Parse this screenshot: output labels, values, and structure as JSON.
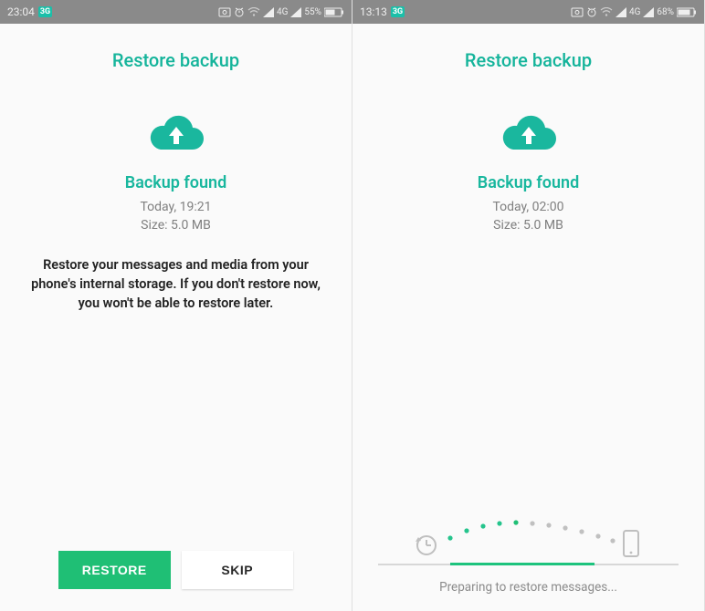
{
  "colors": {
    "teal": "#19b79e",
    "green": "#1dc37d",
    "grey": "#8a8a8a"
  },
  "left": {
    "status": {
      "time": "23:04",
      "signal_badge": "3G",
      "net": "4G",
      "battery": "55%"
    },
    "title": "Restore backup",
    "subheading": "Backup found",
    "meta_line1": "Today, 19:21",
    "meta_line2": "Size: 5.0 MB",
    "body": "Restore your messages and media from your phone's internal storage. If you don't restore now, you won't be able to restore later.",
    "buttons": {
      "restore": "RESTORE",
      "skip": "SKIP"
    }
  },
  "right": {
    "status": {
      "time": "13:13",
      "signal_badge": "3G",
      "net": "4G",
      "battery": "68%"
    },
    "title": "Restore backup",
    "subheading": "Backup found",
    "meta_line1": "Today, 02:00",
    "meta_line2": "Size: 5.0 MB",
    "progress_label": "Preparing to restore messages..."
  }
}
